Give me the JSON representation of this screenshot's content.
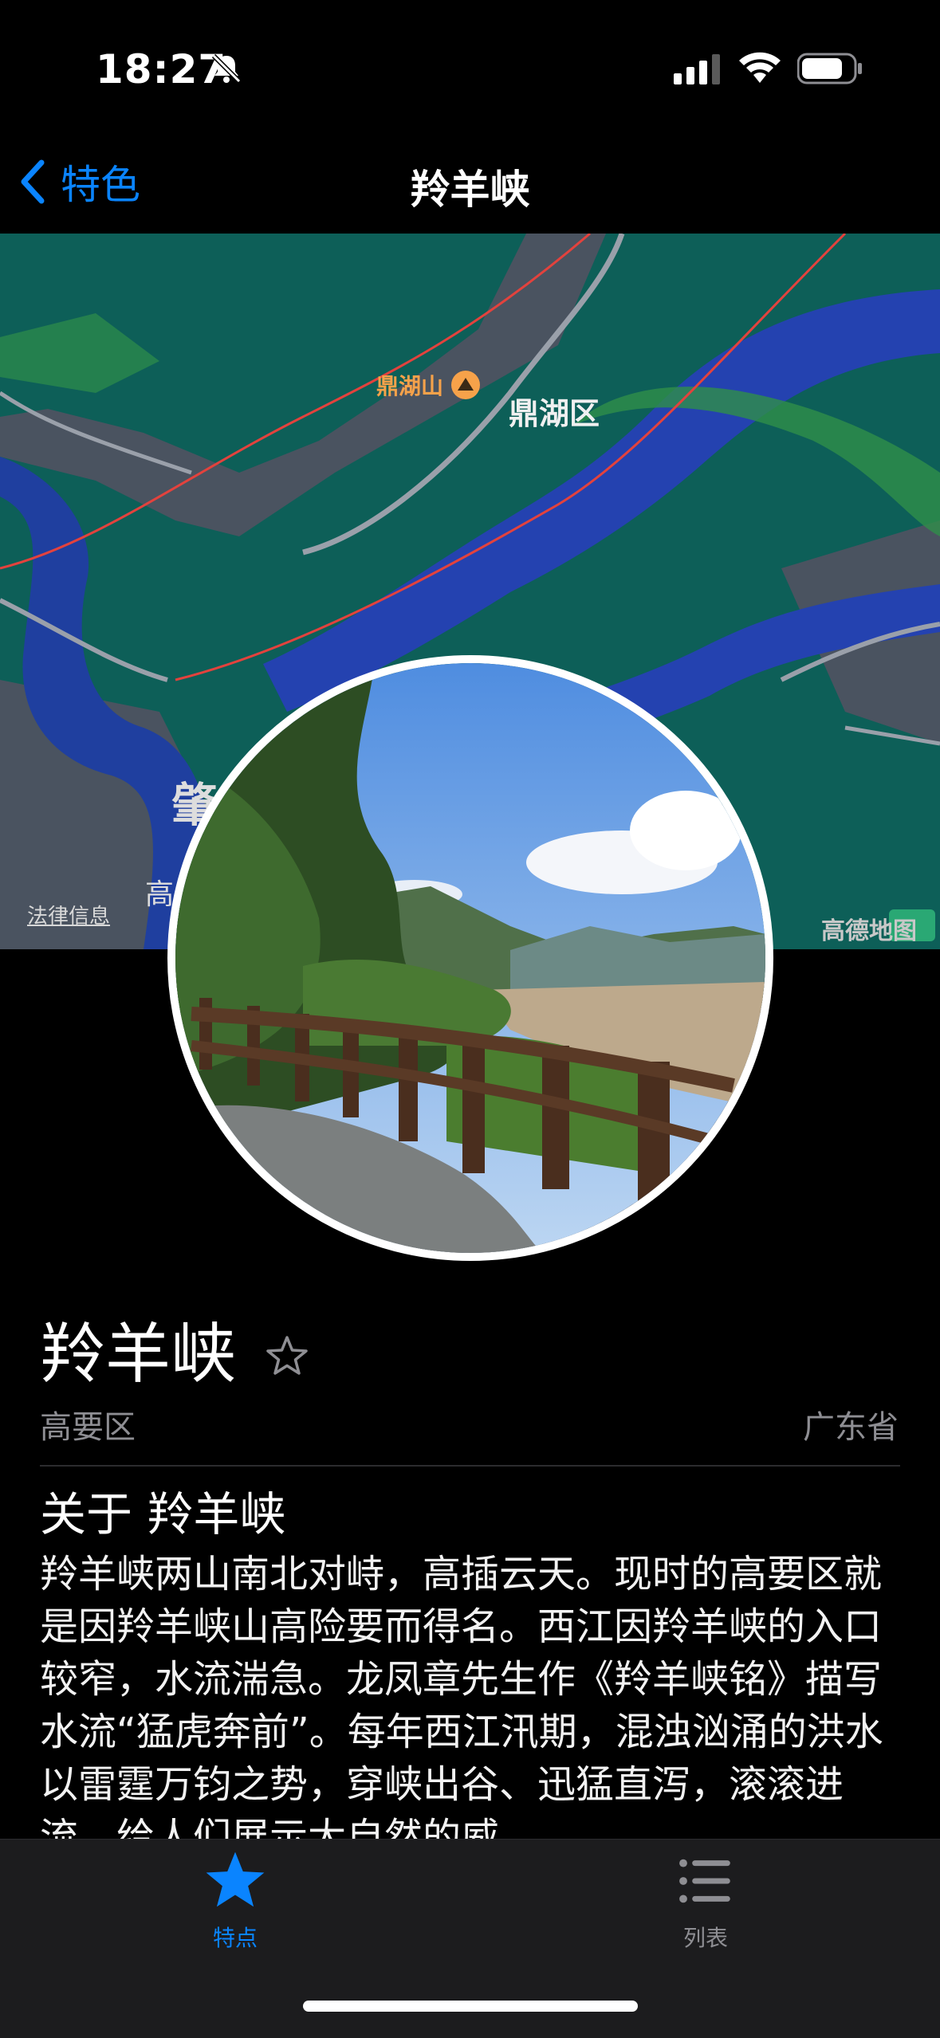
{
  "status_bar": {
    "time": "18:27"
  },
  "nav": {
    "back_label": "特色",
    "title": "羚羊峡"
  },
  "map": {
    "peak_label": "鼎湖山",
    "district_label": "鼎湖区",
    "city_partial": "肇",
    "area_partial": "高",
    "legal_link": "法律信息",
    "attribution": "高德地图"
  },
  "place": {
    "name": "羚羊峡",
    "district": "高要区",
    "province": "广东省"
  },
  "about": {
    "title": "关于 羚羊峡",
    "text": "羚羊峡两山南北对峙，高插云天。现时的高要区就是因羚羊峡山高险要而得名。西江因羚羊峡的入口较窄，水流湍急。龙凤章先生作《羚羊峡铭》描写水流“猛虎奔前”。每年西江汛期，混浊汹涌的洪水以雷霆万钧之势，穿峡出谷、迅猛直泻，滚滚进流，给人们展示大自然的威"
  },
  "tabs": [
    {
      "label": "特点",
      "icon": "star-fill-icon",
      "active": true,
      "color": "#0a84ff"
    },
    {
      "label": "列表",
      "icon": "list-icon",
      "active": false,
      "color": "#8e8e93"
    }
  ]
}
